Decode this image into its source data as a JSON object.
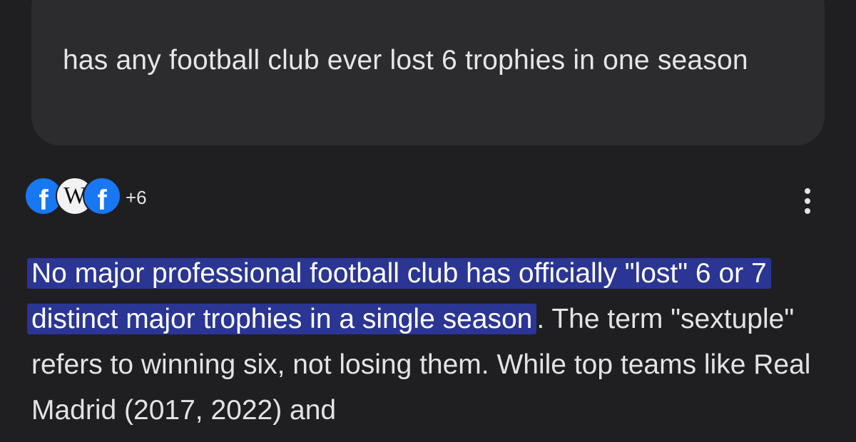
{
  "query": {
    "text": "has any football club ever lost 6 trophies in one season"
  },
  "sources": {
    "icons": [
      {
        "name": "facebook-icon",
        "glyph": "f"
      },
      {
        "name": "wikipedia-icon",
        "glyph": "W"
      },
      {
        "name": "facebook-icon",
        "glyph": "f"
      }
    ],
    "more_count": "+6"
  },
  "answer": {
    "highlighted": "No major professional football club has officially \"lost\" 6 or 7 distinct major trophies in a single season",
    "rest": ". The term \"sextuple\" refers to winning six, not losing them. While top teams like Real Madrid (2017, 2022) and"
  },
  "colors": {
    "background": "#1f1f21",
    "bubble": "#2c2c2e",
    "highlight": "#2a3594",
    "facebook": "#1877f2"
  }
}
